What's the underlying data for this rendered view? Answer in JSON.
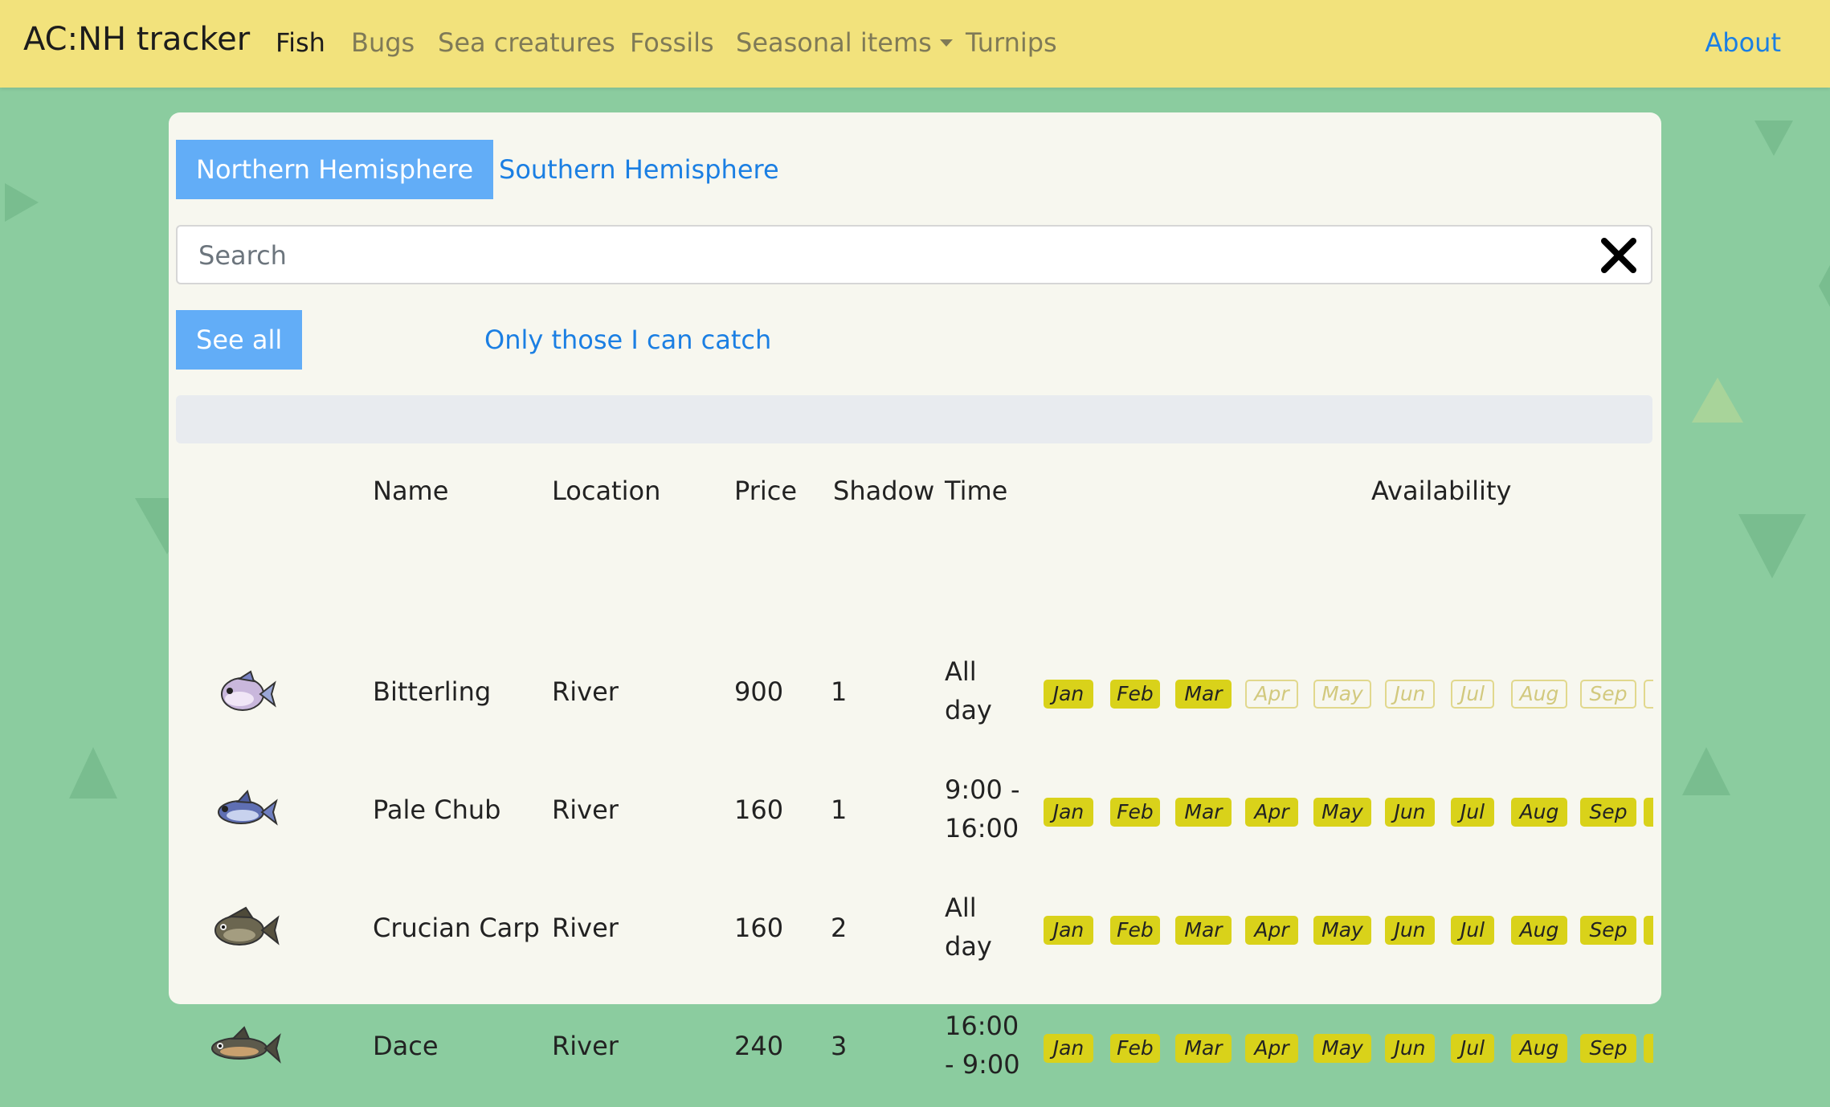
{
  "navbar": {
    "brand": "AC:NH tracker",
    "items": [
      "Fish",
      "Bugs",
      "Sea creatures",
      "Fossils",
      "Seasonal items",
      "Turnips"
    ],
    "about": "About"
  },
  "hemisphere_tabs": [
    "Northern Hemisphere",
    "Southern Hemisphere"
  ],
  "search": {
    "placeholder": "Search",
    "value": ""
  },
  "filter_tabs": [
    "See all",
    "Only those I can catch"
  ],
  "table": {
    "headers": [
      "Name",
      "Location",
      "Price",
      "Shadow",
      "Time",
      "Availability"
    ],
    "month_labels": [
      "Jan",
      "Feb",
      "Mar",
      "Apr",
      "May",
      "Jun",
      "Jul",
      "Aug",
      "Sep"
    ],
    "rows": [
      {
        "icon": "bitterling-icon",
        "name": "Bitterling",
        "location": "River",
        "price": "900",
        "shadow": "1",
        "time_line1": "All",
        "time_line2": "day",
        "available": [
          true,
          true,
          true,
          false,
          false,
          false,
          false,
          false,
          false
        ]
      },
      {
        "icon": "pale-chub-icon",
        "name": "Pale Chub",
        "location": "River",
        "price": "160",
        "shadow": "1",
        "time_line1": "9:00 -",
        "time_line2": "16:00",
        "available": [
          true,
          true,
          true,
          true,
          true,
          true,
          true,
          true,
          true
        ]
      },
      {
        "icon": "crucian-carp-icon",
        "name": "Crucian Carp",
        "location": "River",
        "price": "160",
        "shadow": "2",
        "time_line1": "All",
        "time_line2": "day",
        "available": [
          true,
          true,
          true,
          true,
          true,
          true,
          true,
          true,
          true
        ]
      },
      {
        "icon": "dace-icon",
        "name": "Dace",
        "location": "River",
        "price": "240",
        "shadow": "3",
        "time_line1": "16:00",
        "time_line2": "- 9:00",
        "available": [
          true,
          true,
          true,
          true,
          true,
          true,
          true,
          true,
          true
        ]
      }
    ]
  },
  "colors": {
    "background": "#8bcc9f",
    "navbar": "#f2e27c",
    "card": "#f7f7ef",
    "active_pill": "#62adf7",
    "link": "#1b7fe3",
    "month_available": "#d9d21a"
  }
}
